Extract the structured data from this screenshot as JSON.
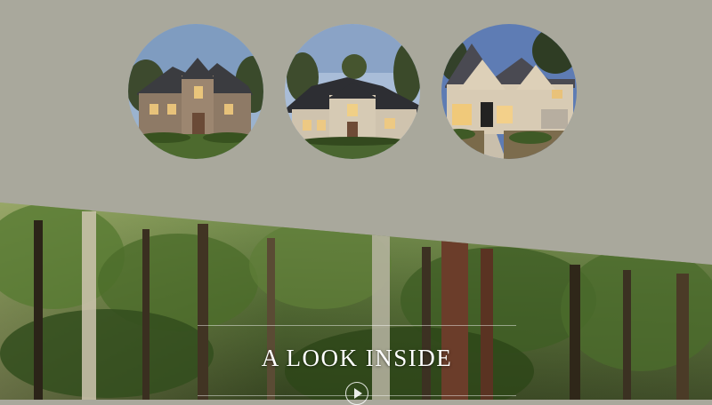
{
  "colors": {
    "background": "#a9a89c",
    "title_text": "#ffffff"
  },
  "homes": [
    {
      "alt": "stone-two-story-home"
    },
    {
      "alt": "stucco-home-with-dark-roof"
    },
    {
      "alt": "cream-stucco-home-with-arched-entry"
    }
  ],
  "inside": {
    "title": "A LOOK INSIDE",
    "play_icon": "play-icon"
  }
}
